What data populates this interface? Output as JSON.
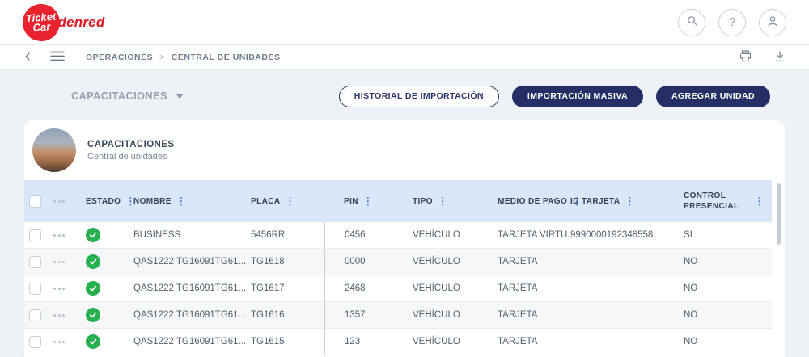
{
  "header": {
    "logo": {
      "line1": "Ticket",
      "line2": "Car",
      "brand": "Edenred"
    },
    "help_glyph": "?"
  },
  "breadcrumb": {
    "separator": ">",
    "items": [
      "OPERACIONES",
      "CENTRAL DE UNIDADES"
    ]
  },
  "toolbar": {
    "section_dropdown": "CAPACITACIONES",
    "history_button": "HISTORIAL DE IMPORTACIÓN",
    "bulk_import_button": "IMPORTACIÓN MASIVA",
    "add_unit_button": "AGREGAR UNIDAD"
  },
  "card": {
    "title": "CAPACITACIONES",
    "subtitle": "Central de unidades"
  },
  "table": {
    "sort_glyph": "⋮",
    "columns": [
      "ESTADO",
      "NOMBRE",
      "PLACA",
      "PIN",
      "TIPO",
      "MEDIO DE PAGO",
      "ID TARJETA",
      "CONTROL PRESENCIAL"
    ],
    "rows": [
      {
        "estado": "ok",
        "nombre": "BUSINESS",
        "placa": "5456RR",
        "pin": "0456",
        "tipo": "VEHÍCULO",
        "medio_de_pago": "TARJETA VIRTU...",
        "id_tarjeta": "9990000192348558",
        "control_presencial": "SI"
      },
      {
        "estado": "ok",
        "nombre": "QAS1222 TG16091TG61...",
        "placa": "TG1618",
        "pin": "0000",
        "tipo": "VEHÍCULO",
        "medio_de_pago": "TARJETA",
        "id_tarjeta": "",
        "control_presencial": "NO"
      },
      {
        "estado": "ok",
        "nombre": "QAS1222 TG16091TG61...",
        "placa": "TG1617",
        "pin": "2468",
        "tipo": "VEHÍCULO",
        "medio_de_pago": "TARJETA",
        "id_tarjeta": "",
        "control_presencial": "NO"
      },
      {
        "estado": "ok",
        "nombre": "QAS1222 TG16091TG61...",
        "placa": "TG1616",
        "pin": "1357",
        "tipo": "VEHÍCULO",
        "medio_de_pago": "TARJETA",
        "id_tarjeta": "",
        "control_presencial": "NO"
      },
      {
        "estado": "ok",
        "nombre": "QAS1222 TG16091TG61...",
        "placa": "TG1615",
        "pin": "123",
        "tipo": "VEHÍCULO",
        "medio_de_pago": "TARJETA",
        "id_tarjeta": "",
        "control_presencial": "NO"
      }
    ]
  },
  "colors": {
    "navy": "#252f66",
    "brand_red": "#e8232e",
    "status_green": "#27b04e",
    "table_header_blue": "#d9e7f8",
    "sort_blue": "#3f79da"
  }
}
